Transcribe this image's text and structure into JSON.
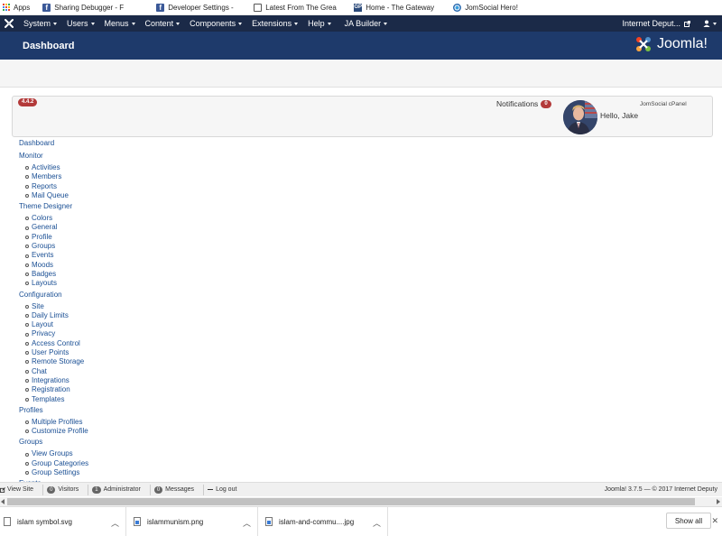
{
  "bookmarks": [
    {
      "label": "Apps",
      "icon": "apps-grid-icon"
    },
    {
      "label": "Sharing Debugger - F",
      "icon": "facebook-icon"
    },
    {
      "label": "Developer Settings -",
      "icon": "facebook-icon"
    },
    {
      "label": "Latest From The Grea",
      "icon": "document-icon"
    },
    {
      "label": "Home - The Gateway",
      "icon": "gateway-icon"
    },
    {
      "label": "JomSocial Hero!",
      "icon": "jomsocial-icon"
    }
  ],
  "topnav": {
    "items": [
      "System",
      "Users",
      "Menus",
      "Content",
      "Components",
      "Extensions",
      "Help",
      "JA Builder"
    ],
    "site_link": "Internet Deput...",
    "user_icon": "user-icon"
  },
  "header": {
    "title": "Dashboard",
    "brand": "Joomla!"
  },
  "panel": {
    "version": "4.4.2",
    "notifications_label": "Notifications",
    "notifications_count": "0",
    "cpanel_label": "JomSocial cPanel",
    "greeting": "Hello, Jake"
  },
  "menu": {
    "dashboard": "Dashboard",
    "sections": [
      {
        "title": "Monitor",
        "items": [
          "Activities",
          "Members",
          "Reports",
          "Mail Queue"
        ]
      },
      {
        "title": "Theme Designer",
        "items": [
          "Colors",
          "General",
          "Profile",
          "Groups",
          "Events",
          "Moods",
          "Badges",
          "Layouts"
        ]
      },
      {
        "title": "Configuration",
        "items": [
          "Site",
          "Daily Limits",
          "Layout",
          "Privacy",
          "Access Control",
          "User Points",
          "Remote Storage",
          "Chat",
          "Integrations",
          "Registration",
          "Templates"
        ]
      },
      {
        "title": "Profiles",
        "items": [
          "Multiple Profiles",
          "Customize Profile"
        ]
      },
      {
        "title": "Groups",
        "items": [
          "View Groups",
          "Group Categories",
          "Group Settings"
        ]
      },
      {
        "title": "Events",
        "items": []
      }
    ]
  },
  "statusbar": {
    "view_site": "View Site",
    "visitors_count": "0",
    "visitors_label": "Visitors",
    "admin_count": "1",
    "admin_label": "Administrator",
    "messages_count": "0",
    "messages_label": "Messages",
    "logout": "Log out",
    "footer": "Joomla! 3.7.5 — © 2017 Internet Deputy"
  },
  "downloads": {
    "files": [
      "islam symbol.svg",
      "islammunism.png",
      "islam-and-commu....jpg"
    ],
    "show_all": "Show all"
  },
  "colors": {
    "nav_bg": "#1b2a48",
    "header_bg": "#1e3a6b",
    "badge_red": "#b33a3a",
    "link_blue": "#1a4f94"
  }
}
